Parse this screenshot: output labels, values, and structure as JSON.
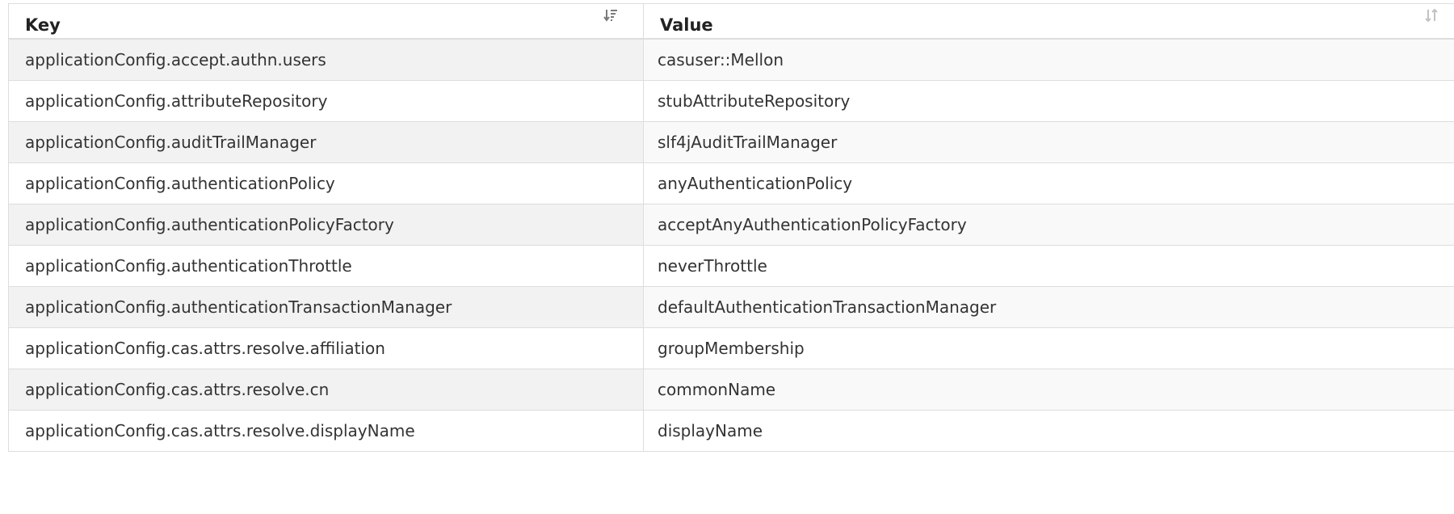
{
  "table": {
    "headers": {
      "key": "Key",
      "value": "Value"
    },
    "icons": {
      "key_sort": "sort-amount-down-icon",
      "value_sort": "sort-both-icon"
    },
    "rows": [
      {
        "key": "applicationConfig.accept.authn.users",
        "value": "casuser::Mellon"
      },
      {
        "key": "applicationConfig.attributeRepository",
        "value": "stubAttributeRepository"
      },
      {
        "key": "applicationConfig.auditTrailManager",
        "value": "slf4jAuditTrailManager"
      },
      {
        "key": "applicationConfig.authenticationPolicy",
        "value": "anyAuthenticationPolicy"
      },
      {
        "key": "applicationConfig.authenticationPolicyFactory",
        "value": "acceptAnyAuthenticationPolicyFactory"
      },
      {
        "key": "applicationConfig.authenticationThrottle",
        "value": "neverThrottle"
      },
      {
        "key": "applicationConfig.authenticationTransactionManager",
        "value": "defaultAuthenticationTransactionManager"
      },
      {
        "key": "applicationConfig.cas.attrs.resolve.affiliation",
        "value": "groupMembership"
      },
      {
        "key": "applicationConfig.cas.attrs.resolve.cn",
        "value": "commonName"
      },
      {
        "key": "applicationConfig.cas.attrs.resolve.displayName",
        "value": "displayName"
      }
    ]
  }
}
